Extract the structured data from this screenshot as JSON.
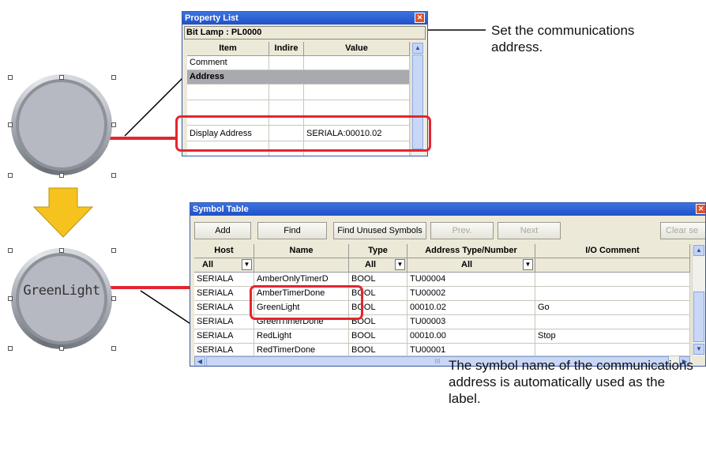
{
  "top_lamp": {
    "label": ""
  },
  "bottom_lamp": {
    "label": "GreenLight"
  },
  "property_list": {
    "title": "Property List",
    "subtitle": "Bit Lamp : PL0000",
    "columns": [
      "Item",
      "Indire",
      "Value"
    ],
    "rows": [
      {
        "item": "Comment",
        "indirect": "",
        "value": ""
      },
      {
        "item": "Address",
        "indirect": "",
        "value": "",
        "section": true
      },
      {
        "item": "",
        "indirect": "",
        "value": ""
      },
      {
        "item": "",
        "indirect": "",
        "value": ""
      },
      {
        "item": "Display Address",
        "indirect": "",
        "value": "SERIALA:00010.02"
      },
      {
        "item": "",
        "indirect": "",
        "value": ""
      }
    ]
  },
  "symbol_table": {
    "title": "Symbol Table",
    "toolbar": [
      "Add",
      "Find",
      "Find Unused Symbols",
      "Prev.",
      "Next",
      "Clear se"
    ],
    "columns": [
      "Host",
      "Name",
      "Type",
      "Address Type/Number",
      "I/O Comment"
    ],
    "filters": [
      "All",
      "",
      "All",
      "All",
      ""
    ],
    "rows": [
      [
        "SERIALA",
        "AmberOnlyTimerD",
        "BOOL",
        "TU00004",
        ""
      ],
      [
        "SERIALA",
        "AmberTimerDone",
        "BOOL",
        "TU00002",
        ""
      ],
      [
        "SERIALA",
        "GreenLight",
        "BOOL",
        "00010.02",
        "Go"
      ],
      [
        "SERIALA",
        "GreenTimerDone",
        "BOOL",
        "TU00003",
        ""
      ],
      [
        "SERIALA",
        "RedLight",
        "BOOL",
        "00010.00",
        "Stop"
      ],
      [
        "SERIALA",
        "RedTimerDone",
        "BOOL",
        "TU00001",
        ""
      ]
    ],
    "scroll_mark": "III"
  },
  "callouts": {
    "address": "Set the communications address.",
    "label": "The symbol name of the communications address is automatically used as the label."
  },
  "colors": {
    "accent_red": "#e3262e",
    "arrow_yellow": "#f6c21d",
    "title_blue": "#2a5fd6"
  }
}
